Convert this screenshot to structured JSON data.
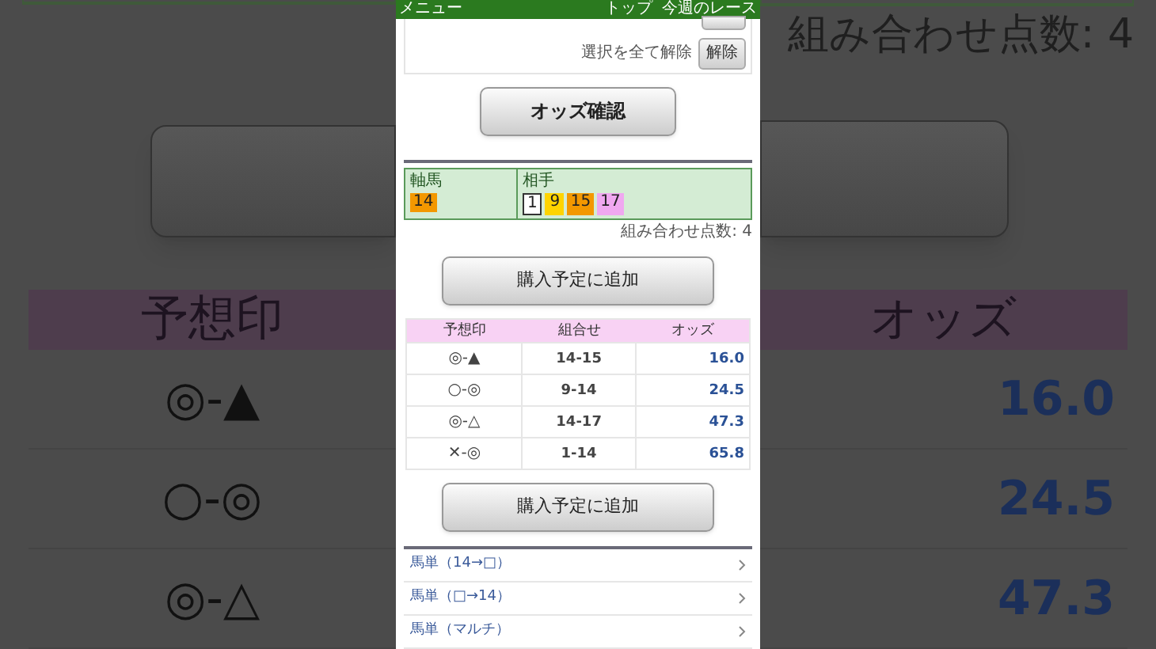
{
  "backdrop": {
    "count_text": "組み合わせ点数: 4",
    "columns": [
      "予想印",
      "オッズ"
    ],
    "rows": [
      {
        "marks": "◎-▲",
        "odds": "16.0"
      },
      {
        "marks": "○-◎",
        "odds": "24.5"
      },
      {
        "marks": "◎-△",
        "odds": "47.3"
      }
    ]
  },
  "header": {
    "menu": "メニュー",
    "links": [
      "トップ",
      "今週のレース"
    ]
  },
  "selection": {
    "label": "選択を全て解除",
    "button": "解除"
  },
  "odds_button": "オッズ確認",
  "picks": {
    "axis_label": "軸馬",
    "axis": [
      {
        "number": "14",
        "color": "#f39800"
      }
    ],
    "partner_label": "相手",
    "partners": [
      {
        "number": "1",
        "color": "#ffffff"
      },
      {
        "number": "9",
        "color": "#ffd400"
      },
      {
        "number": "15",
        "color": "#f39800"
      },
      {
        "number": "17",
        "color": "#f0a8f0"
      }
    ]
  },
  "count_text": "組み合わせ点数: 4",
  "add_button_1": "購入予定に追加",
  "table": {
    "columns": [
      "予想印",
      "組合せ",
      "オッズ"
    ],
    "rows": [
      {
        "marks": "◎-▲",
        "combo": "14-15",
        "odds": "16.0"
      },
      {
        "marks": "○-◎",
        "combo": "9-14",
        "odds": "24.5"
      },
      {
        "marks": "◎-△",
        "combo": "14-17",
        "odds": "47.3"
      },
      {
        "marks": "✕-◎",
        "combo": "1-14",
        "odds": "65.8"
      }
    ]
  },
  "add_button_2": "購入予定に追加",
  "links": [
    "馬単（14→□）",
    "馬単（□→14）",
    "馬単（マルチ）"
  ]
}
